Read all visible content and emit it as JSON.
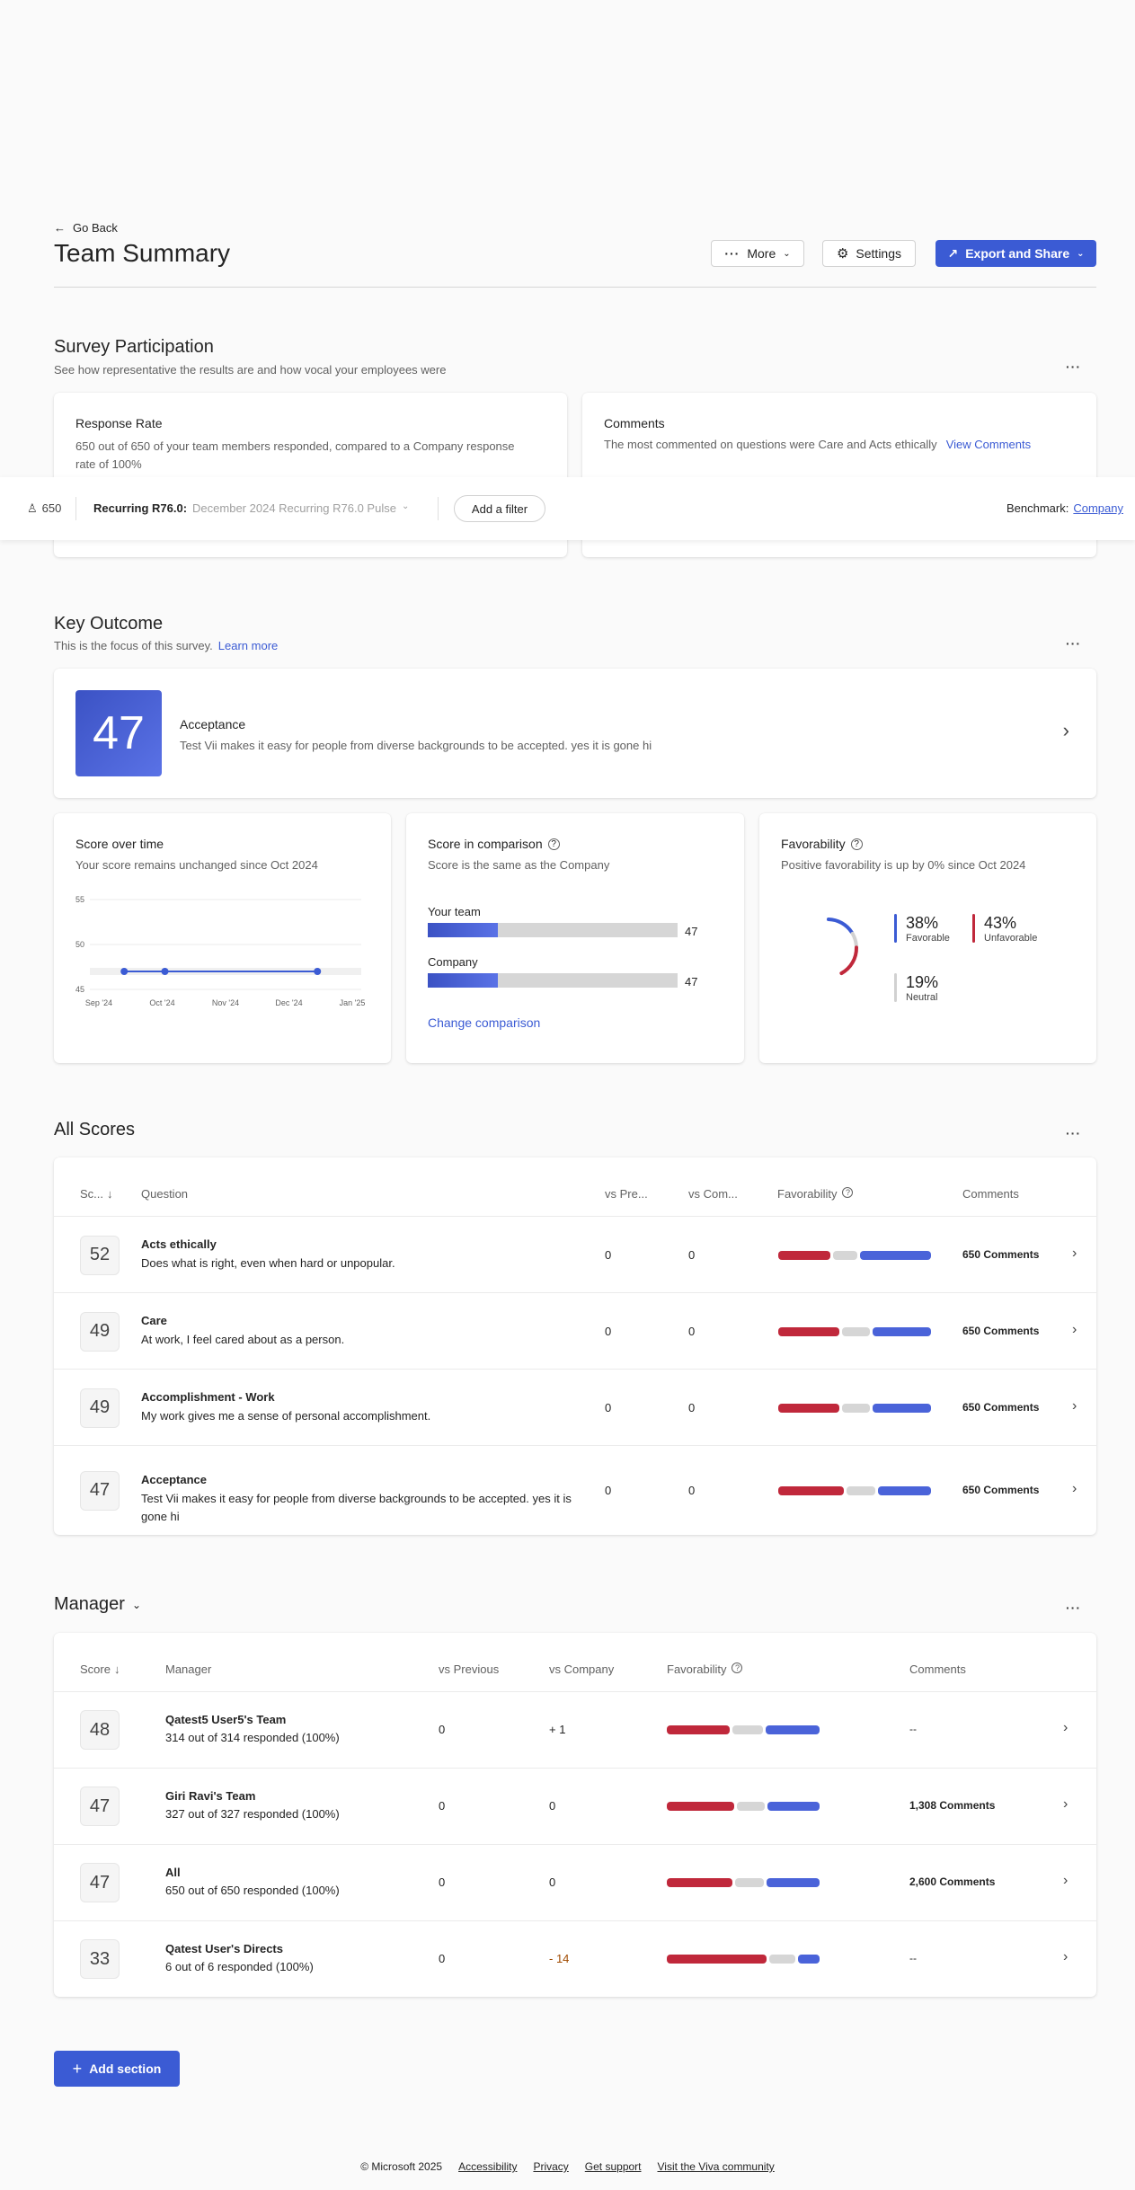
{
  "header": {
    "back_label": "Go Back",
    "title": "Team Summary",
    "more_label": "More",
    "settings_label": "Settings",
    "export_label": "Export and Share"
  },
  "participation": {
    "title": "Survey Participation",
    "subtitle": "See how representative the results are and how vocal your employees were",
    "response_card": {
      "title": "Response Rate",
      "text": "650 out of 650 of your team members responded, compared to a Company response rate of 100%"
    },
    "comments_card": {
      "title": "Comments",
      "text": "The most commented on questions were Care and Acts ethically",
      "link": "View Comments"
    }
  },
  "filterbar": {
    "count": "650",
    "survey_label": "Recurring R76.0:",
    "survey_value": "December 2024 Recurring R76.0 Pulse",
    "add_filter": "Add a filter",
    "benchmark_label": "Benchmark:",
    "benchmark_value": "Company"
  },
  "key_outcome": {
    "title": "Key Outcome",
    "subtitle": "This is the focus of this survey.",
    "learn_more": "Learn more",
    "score": "47",
    "name": "Acceptance",
    "description": "Test Vii makes it easy for people from diverse backgrounds to be accepted. yes it is gone hi",
    "accent": "#4a63d9"
  },
  "score_over_time": {
    "title": "Score over time",
    "subtitle": "Your score remains unchanged since Oct 2024"
  },
  "score_comparison": {
    "title": "Score in comparison",
    "subtitle": "Score is the same as the Company",
    "rows": [
      {
        "label": "Your team",
        "value": "47",
        "fraction": 0.47
      },
      {
        "label": "Company",
        "value": "47",
        "fraction": 0.47
      }
    ],
    "change_link": "Change comparison"
  },
  "favorability": {
    "title": "Favorability",
    "subtitle": "Positive favorability is up by 0% since Oct 2024",
    "favorable_pct": "38%",
    "favorable_label": "Favorable",
    "unfavorable_pct": "43%",
    "unfavorable_label": "Unfavorable",
    "neutral_pct": "19%",
    "neutral_label": "Neutral",
    "colors": {
      "favorable": "#3b5bd4",
      "unfavorable": "#c0283b",
      "neutral": "#d1d1d1"
    }
  },
  "chart_data": {
    "type": "line",
    "title": "Score over time",
    "xlabel": "",
    "ylabel": "",
    "x": [
      "Oct '24",
      "Nov '24",
      "Jan '25"
    ],
    "x_ticks": [
      "Sep '24",
      "Oct '24",
      "Nov '24",
      "Dec '24",
      "Jan '25"
    ],
    "y_ticks": [
      "55",
      "50",
      "45"
    ],
    "ylim": [
      45,
      55
    ],
    "series": [
      {
        "values": [
          47,
          47,
          47
        ]
      }
    ],
    "grid": true
  },
  "all_scores": {
    "title": "All Scores",
    "headers": {
      "score": "Sc...",
      "question": "Question",
      "vs_prev": "vs Pre...",
      "vs_comp": "vs Com...",
      "favorability": "Favorability",
      "comments": "Comments"
    },
    "rows": [
      {
        "score": "52",
        "title": "Acts ethically",
        "desc": "Does what is right, even when hard or unpopular.",
        "vs_prev": "0",
        "vs_comp": "0",
        "unfav": 0.34,
        "neutral": 0.16,
        "fav": 0.5,
        "comments": "650 Comments"
      },
      {
        "score": "49",
        "title": "Care",
        "desc": "At work, I feel cared about as a person.",
        "vs_prev": "0",
        "vs_comp": "0",
        "unfav": 0.4,
        "neutral": 0.18,
        "fav": 0.42,
        "comments": "650 Comments"
      },
      {
        "score": "49",
        "title": "Accomplishment - Work",
        "desc": "My work gives me a sense of personal accomplishment.",
        "vs_prev": "0",
        "vs_comp": "0",
        "unfav": 0.4,
        "neutral": 0.18,
        "fav": 0.42,
        "comments": "650 Comments"
      },
      {
        "score": "47",
        "title": "Acceptance",
        "desc": "Test Vii makes it easy for people from diverse backgrounds to be accepted. yes it is gone hi",
        "vs_prev": "0",
        "vs_comp": "0",
        "unfav": 0.43,
        "neutral": 0.19,
        "fav": 0.38,
        "comments": "650 Comments"
      }
    ]
  },
  "manager": {
    "title": "Manager",
    "headers": {
      "score": "Score",
      "manager": "Manager",
      "vs_prev": "vs Previous",
      "vs_comp": "vs Company",
      "favorability": "Favorability",
      "comments": "Comments"
    },
    "rows": [
      {
        "score": "48",
        "name": "Qatest5 User5's Team",
        "sub": "314 out of 314 responded (100%)",
        "vs_prev": "0",
        "vs_comp": "+ 1",
        "comp_color": "#242424",
        "unfav": 0.41,
        "neutral": 0.2,
        "fav": 0.39,
        "comments": "--",
        "link": false
      },
      {
        "score": "47",
        "name": "Giri Ravi's Team",
        "sub": "327 out of 327 responded (100%)",
        "vs_prev": "0",
        "vs_comp": "0",
        "comp_color": "#242424",
        "unfav": 0.44,
        "neutral": 0.18,
        "fav": 0.38,
        "comments": "1,308 Comments",
        "link": true
      },
      {
        "score": "47",
        "name": "All",
        "sub": "650 out of 650 responded (100%)",
        "vs_prev": "0",
        "vs_comp": "0",
        "comp_color": "#242424",
        "unfav": 0.43,
        "neutral": 0.19,
        "fav": 0.38,
        "comments": "2,600 Comments",
        "link": true
      },
      {
        "score": "33",
        "name": "Qatest User's Directs",
        "sub": "6 out of 6 responded (100%)",
        "vs_prev": "0",
        "vs_comp": "- 14",
        "comp_color": "#a04a00",
        "unfav": 0.65,
        "neutral": 0.17,
        "fav": 0.18,
        "comments": "--",
        "link": false
      }
    ]
  },
  "add_section_label": "Add section",
  "footer": {
    "copyright": "© Microsoft 2025",
    "links": [
      "Accessibility",
      "Privacy",
      "Get support",
      "Visit the Viva community"
    ]
  }
}
